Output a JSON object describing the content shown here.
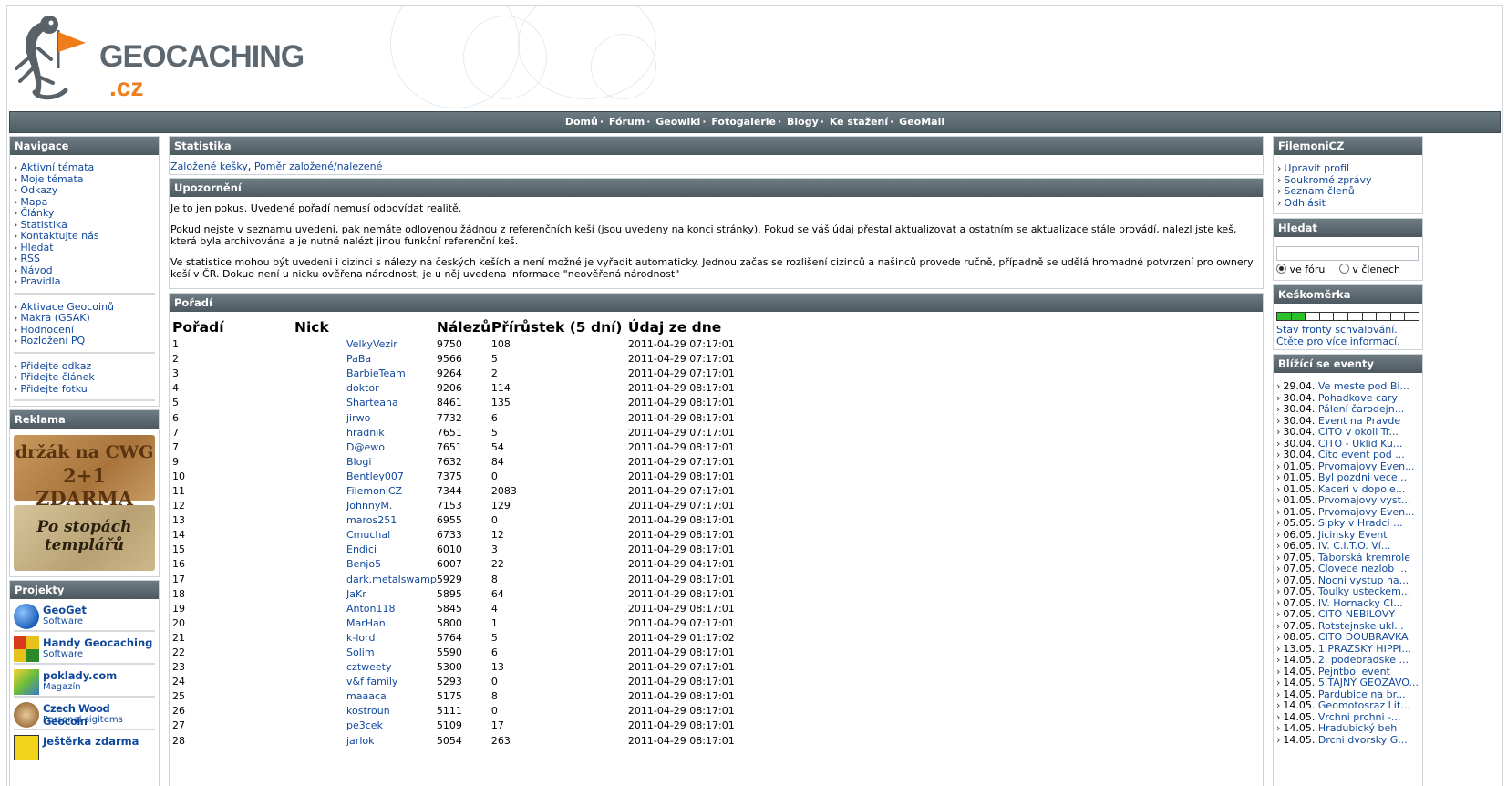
{
  "logo": {
    "main": "GEOCACHING",
    "suffix": ".cz"
  },
  "topnav": [
    "Domů",
    "Fórum",
    "Geowiki",
    "Fotogalerie",
    "Blogy",
    "Ke stažení",
    "GeoMail"
  ],
  "left": {
    "nav_title": "Navigace",
    "nav_group1": [
      "Aktivní témata",
      "Moje témata",
      "Odkazy",
      "Mapa",
      "Články",
      "Statistika",
      "Kontaktujte nás",
      "Hledat",
      "RSS",
      "Návod",
      "Pravidla"
    ],
    "nav_group2": [
      "Aktivace Geocoinů",
      "Makra (GSAK)",
      "Hodnocení",
      "Rozložení PQ"
    ],
    "nav_group3": [
      "Přidejte odkaz",
      "Přidejte článek",
      "Přidejte fotku"
    ],
    "ads_title": "Reklama",
    "ad1": {
      "line1": "držák na CWG",
      "line2": "2+1 ZDARMA"
    },
    "ad2": {
      "line1": "Po stopách",
      "line2": "templářů"
    },
    "projects_title": "Projekty",
    "projects": [
      {
        "title": "GeoGet",
        "sub": "Software"
      },
      {
        "title": "Handy Geocaching",
        "sub": "Software"
      },
      {
        "title": "poklady.com",
        "sub": "Magazín"
      },
      {
        "title": "Czech Wood Geocoin",
        "sub": "Personal sigitems"
      },
      {
        "title": "Ještěrka zdarma",
        "sub": ""
      }
    ]
  },
  "main": {
    "stats_title": "Statistika",
    "stats_link1": "Založené kešky",
    "stats_link2": "Poměr založené/nalezené",
    "notice_title": "Upozornění",
    "notice_p1": "Je to jen pokus. Uvedené pořadí nemusí odpovídat realitě.",
    "notice_p2": "Pokud nejste v seznamu uvedeni, pak nemáte odlovenou žádnou z referenčních keší (jsou uvedeny na konci stránky). Pokud se váš údaj přestal aktualizovat a ostatním se aktualizace stále provádí, nalezl jste keš, která byla archivována a je nutné nalézt jinou funkční referenční keš.",
    "notice_p3": "Ve statistice mohou být uvedeni i cizinci s nálezy na českých keších a není možné je vyřadit automaticky. Jednou začas se rozlišení cizinců a našinců provede ručně, případně se udělá hromadné potvrzení pro ownery keší v ČR. Dokud není u nicku ověřena národnost, je u něj uvedena informace \"neověřená národnost\"",
    "rank_title": "Pořadí",
    "columns": [
      "Pořadí",
      "Nick",
      "Nálezů",
      "Přírůstek (5 dní)",
      "Údaj ze dne"
    ],
    "rows": [
      [
        "1",
        "VelkyVezir",
        "9750",
        "108",
        "2011-04-29 07:17:01"
      ],
      [
        "2",
        "PaBa",
        "9566",
        "5",
        "2011-04-29 07:17:01"
      ],
      [
        "3",
        "BarbieTeam",
        "9264",
        "2",
        "2011-04-29 07:17:01"
      ],
      [
        "4",
        "doktor",
        "9206",
        "114",
        "2011-04-29 08:17:01"
      ],
      [
        "5",
        "Sharteana",
        "8461",
        "135",
        "2011-04-29 08:17:01"
      ],
      [
        "6",
        "jirwo",
        "7732",
        "6",
        "2011-04-29 08:17:01"
      ],
      [
        "7",
        "hradnik",
        "7651",
        "5",
        "2011-04-29 07:17:01"
      ],
      [
        "7",
        "D@ewo",
        "7651",
        "54",
        "2011-04-29 08:17:01"
      ],
      [
        "9",
        "Blogi",
        "7632",
        "84",
        "2011-04-29 07:17:01"
      ],
      [
        "10",
        "Bentley007",
        "7375",
        "0",
        "2011-04-29 08:17:01"
      ],
      [
        "11",
        "FilemoniCZ",
        "7344",
        "2083",
        "2011-04-29 07:17:01"
      ],
      [
        "12",
        "JohnnyM.",
        "7153",
        "129",
        "2011-04-29 07:17:01"
      ],
      [
        "13",
        "maros251",
        "6955",
        "0",
        "2011-04-29 08:17:01"
      ],
      [
        "14",
        "Cmuchal",
        "6733",
        "12",
        "2011-04-29 08:17:01"
      ],
      [
        "15",
        "Endici",
        "6010",
        "3",
        "2011-04-29 08:17:01"
      ],
      [
        "16",
        "Benjo5",
        "6007",
        "22",
        "2011-04-29 04:17:01"
      ],
      [
        "17",
        "dark.metalswamp",
        "5929",
        "8",
        "2011-04-29 08:17:01"
      ],
      [
        "18",
        "JaKr",
        "5895",
        "64",
        "2011-04-29 08:17:01"
      ],
      [
        "19",
        "Anton118",
        "5845",
        "4",
        "2011-04-29 08:17:01"
      ],
      [
        "20",
        "MarHan",
        "5800",
        "1",
        "2011-04-29 07:17:01"
      ],
      [
        "21",
        "k-lord",
        "5764",
        "5",
        "2011-04-29 01:17:02"
      ],
      [
        "22",
        "Solim",
        "5590",
        "6",
        "2011-04-29 08:17:01"
      ],
      [
        "23",
        "cztweety",
        "5300",
        "13",
        "2011-04-29 07:17:01"
      ],
      [
        "24",
        "v&f family",
        "5293",
        "0",
        "2011-04-29 08:17:01"
      ],
      [
        "25",
        "maaaca",
        "5175",
        "8",
        "2011-04-29 08:17:01"
      ],
      [
        "26",
        "kostroun",
        "5111",
        "0",
        "2011-04-29 08:17:01"
      ],
      [
        "27",
        "pe3cek",
        "5109",
        "17",
        "2011-04-29 08:17:01"
      ],
      [
        "28",
        "jarlok",
        "5054",
        "263",
        "2011-04-29 08:17:01"
      ]
    ]
  },
  "right": {
    "user_title": "FilemoniCZ",
    "user_links": [
      "Upravit profil",
      "Soukromé zprávy",
      "Seznam členů",
      "Odhlásit"
    ],
    "search_title": "Hledat",
    "search_value": "",
    "radio1": "ve fóru",
    "radio2": "v členech",
    "queue_title": "Keškoměrka",
    "queue_level": 0.2,
    "queue_line1": "Stav fronty schvalování.",
    "queue_line2": "Čtěte pro více informací.",
    "events_title": "Blížící se eventy",
    "events": [
      [
        "29.04.",
        "Ve meste pod Bi..."
      ],
      [
        "30.04.",
        "Pohadkove cary"
      ],
      [
        "30.04.",
        "Pálení čarodejn..."
      ],
      [
        "30.04.",
        "Event na Pravde"
      ],
      [
        "30.04.",
        "CITO v okoli Tr..."
      ],
      [
        "30.04.",
        "CITO - Uklid Ku..."
      ],
      [
        "30.04.",
        "Cito event pod ..."
      ],
      [
        "01.05.",
        "Prvomajovy Even..."
      ],
      [
        "01.05.",
        "Byl pozdni vece..."
      ],
      [
        "01.05.",
        "Kaceri v dopole..."
      ],
      [
        "01.05.",
        "Prvomajovy vyst..."
      ],
      [
        "01.05.",
        "Prvomajovy Even..."
      ],
      [
        "05.05.",
        "Sipky v Hradci ..."
      ],
      [
        "06.05.",
        "Jicinsky Event"
      ],
      [
        "06.05.",
        "IV. C.I.T.O. Ví..."
      ],
      [
        "07.05.",
        "Táborská kremrole"
      ],
      [
        "07.05.",
        "Clovece nezlob ..."
      ],
      [
        "07.05.",
        "Nocni vystup na..."
      ],
      [
        "07.05.",
        "Toulky usteckem..."
      ],
      [
        "07.05.",
        "IV. Hornacky CI..."
      ],
      [
        "07.05.",
        "CITO NEBILOVY"
      ],
      [
        "07.05.",
        "Rotstejnske ukl..."
      ],
      [
        "08.05.",
        "CITO DOUBRAVKA"
      ],
      [
        "13.05.",
        "1.PRAZSKY HIPPI..."
      ],
      [
        "14.05.",
        "2. podebradske ..."
      ],
      [
        "14.05.",
        "Pejntbol event"
      ],
      [
        "14.05.",
        "5.TAJNÝ GEOZÁVO..."
      ],
      [
        "14.05.",
        "Pardubice na br..."
      ],
      [
        "14.05.",
        "Geomotosraz Lit..."
      ],
      [
        "14.05.",
        "Vrchni prchni -..."
      ],
      [
        "14.05.",
        "Hradubický beh"
      ],
      [
        "14.05.",
        "Drcni dvorsky G..."
      ]
    ]
  }
}
